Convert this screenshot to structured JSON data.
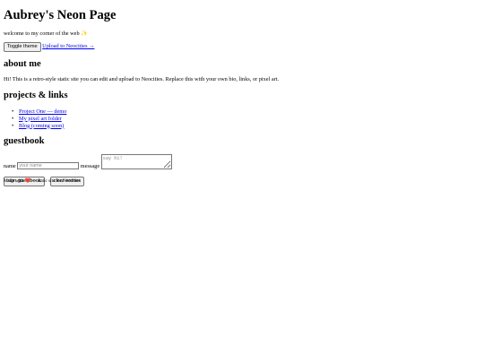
{
  "header": {
    "title": "Aubrey's Neon Page",
    "tagline": "welcome to my corner of the web",
    "sparkle": "✨"
  },
  "toolbar": {
    "toggle_theme_label": "Toggle theme",
    "upload_link_label": "Upload to Neocities →"
  },
  "about": {
    "heading": "about me",
    "text": "Hi! This is a retro-style static site you can edit and upload to Neocities. Replace this with your own bio, links, or pixel art."
  },
  "projects": {
    "heading": "projects & links",
    "links": [
      {
        "label": "Project One — demo"
      },
      {
        "label": "My pixel art folder"
      },
      {
        "label": "Blog (coming soon)"
      }
    ]
  },
  "guestbook": {
    "heading": "guestbook",
    "name_label": "name",
    "name_placeholder": "your name",
    "name_value": "",
    "message_label": "message",
    "message_placeholder": "say hi!",
    "message_value": "",
    "sign_button_label": "sign guestbook",
    "clear_button_label": "clear entries"
  },
  "footer": {
    "prefix": "Made with",
    "heart": "❤️",
    "suffix": "— static site for Neocities"
  }
}
